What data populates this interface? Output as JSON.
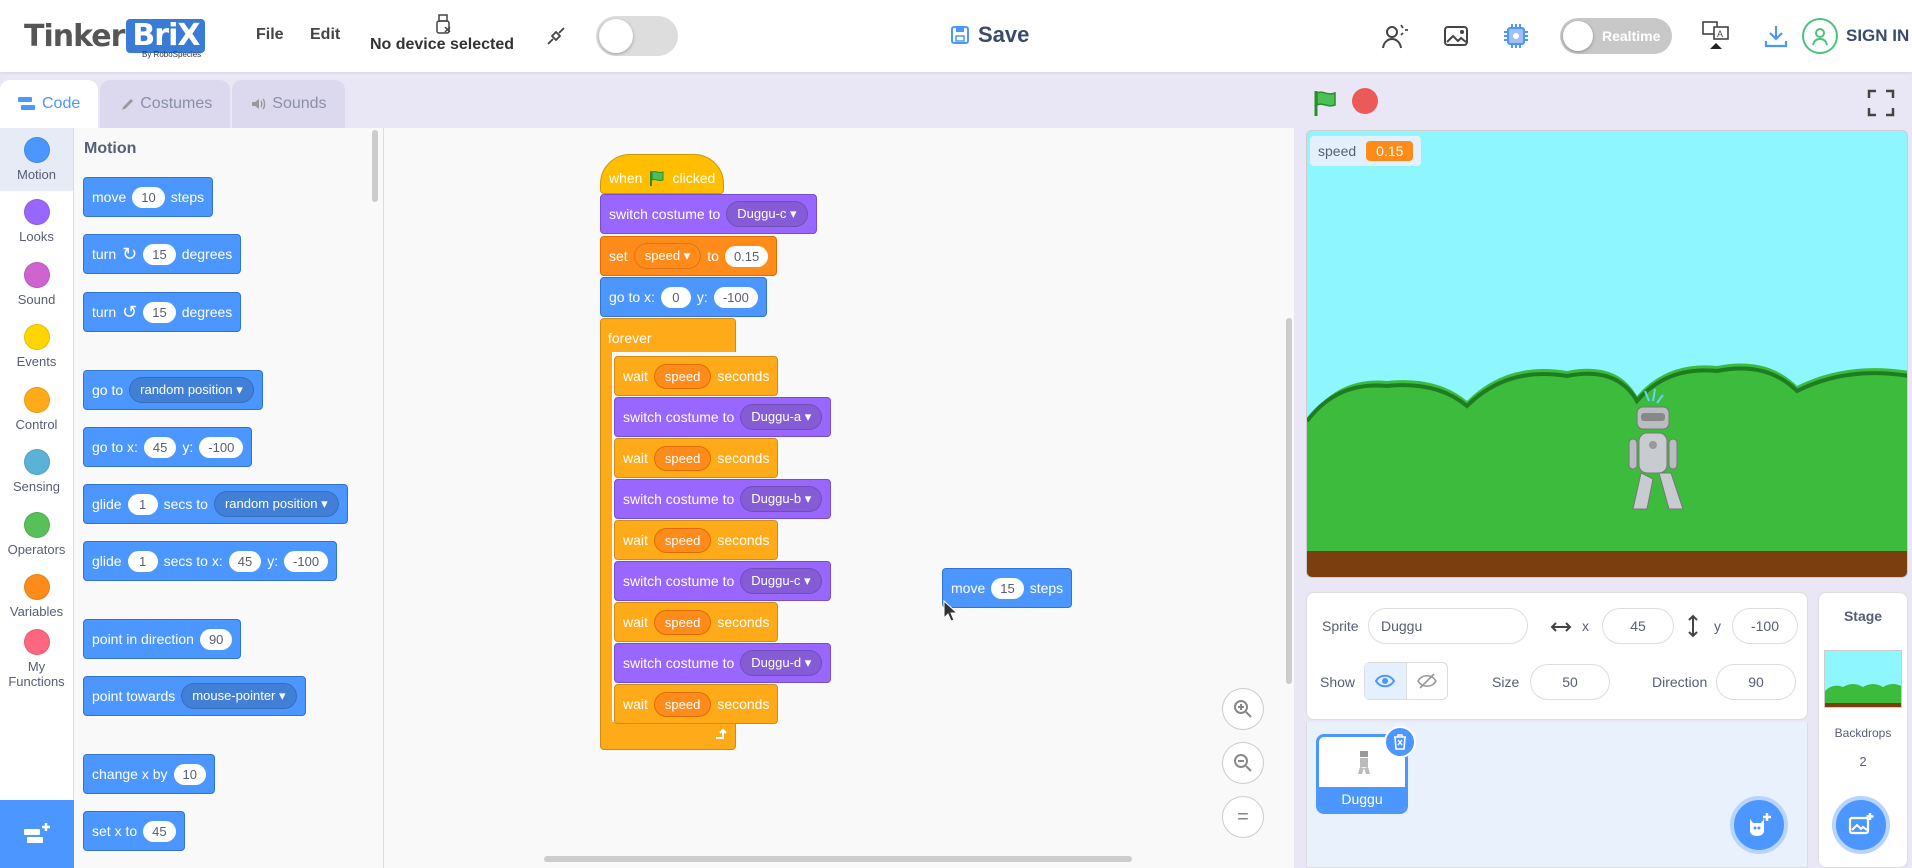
{
  "app": {
    "logo_text": "Tinker",
    "logo_brand": "BriX",
    "logo_sub": "By RoboSpecies"
  },
  "menu": {
    "file": "File",
    "edit": "Edit"
  },
  "device": {
    "label": "No device selected"
  },
  "save": {
    "label": "Save"
  },
  "realtime": {
    "label": "Realtime"
  },
  "signin": {
    "label": "SIGN IN"
  },
  "tabs": [
    {
      "label": "Code"
    },
    {
      "label": "Costumes"
    },
    {
      "label": "Sounds"
    }
  ],
  "categories": [
    {
      "label": "Motion",
      "color": "#4c97ff"
    },
    {
      "label": "Looks",
      "color": "#9966ff"
    },
    {
      "label": "Sound",
      "color": "#cf63cf"
    },
    {
      "label": "Events",
      "color": "#ffd500"
    },
    {
      "label": "Control",
      "color": "#ffab19"
    },
    {
      "label": "Sensing",
      "color": "#5cb1d6"
    },
    {
      "label": "Operators",
      "color": "#59c059"
    },
    {
      "label": "Variables",
      "color": "#ff8c1a"
    },
    {
      "label": "My Functions",
      "color": "#ff6680"
    }
  ],
  "palette": {
    "heading": "Motion",
    "move": {
      "a": "move",
      "n": "10",
      "b": "steps"
    },
    "turn_r": {
      "a": "turn",
      "n": "15",
      "b": "degrees"
    },
    "turn_l": {
      "a": "turn",
      "n": "15",
      "b": "degrees"
    },
    "goto": {
      "a": "go to",
      "d": "random position"
    },
    "gotoxy": {
      "a": "go to x:",
      "x": "45",
      "y_label": "y:",
      "y": "-100"
    },
    "glide1": {
      "a": "glide",
      "n": "1",
      "b": "secs to",
      "d": "random position"
    },
    "glide2": {
      "a": "glide",
      "n": "1",
      "b": "secs to x:",
      "x": "45",
      "y_label": "y:",
      "y": "-100"
    },
    "point": {
      "a": "point in direction",
      "n": "90"
    },
    "towards": {
      "a": "point towards",
      "d": "mouse-pointer"
    },
    "changex": {
      "a": "change x by",
      "n": "10"
    },
    "setx": {
      "a": "set x to",
      "n": "45"
    }
  },
  "script": {
    "hat": {
      "a": "when",
      "b": "clicked"
    },
    "costume1": {
      "a": "switch costume to",
      "d": "Duggu-c"
    },
    "set": {
      "a": "set",
      "d": "speed",
      "b": "to",
      "n": "0.15"
    },
    "goto": {
      "a": "go to x:",
      "x": "0",
      "y_label": "y:",
      "y": "-100"
    },
    "forever": "forever",
    "wait": {
      "a": "wait",
      "r": "speed",
      "b": "seconds"
    },
    "switch": "switch costume to",
    "costumes": [
      "Duggu-a",
      "Duggu-b",
      "Duggu-c",
      "Duggu-d"
    ],
    "loose": {
      "a": "move",
      "n": "15",
      "b": "steps"
    }
  },
  "monitor": {
    "name": "speed",
    "value": "0.15"
  },
  "sprite_info": {
    "sprite_label": "Sprite",
    "sprite_name": "Duggu",
    "x_label": "x",
    "x": "45",
    "y_label": "y",
    "y": "-100",
    "show_label": "Show",
    "size_label": "Size",
    "size": "50",
    "direction_label": "Direction",
    "direction": "90"
  },
  "sprites": [
    {
      "name": "Duggu"
    }
  ],
  "stage_pane": {
    "title": "Stage",
    "backdrops_label": "Backdrops",
    "backdrops": "2"
  }
}
